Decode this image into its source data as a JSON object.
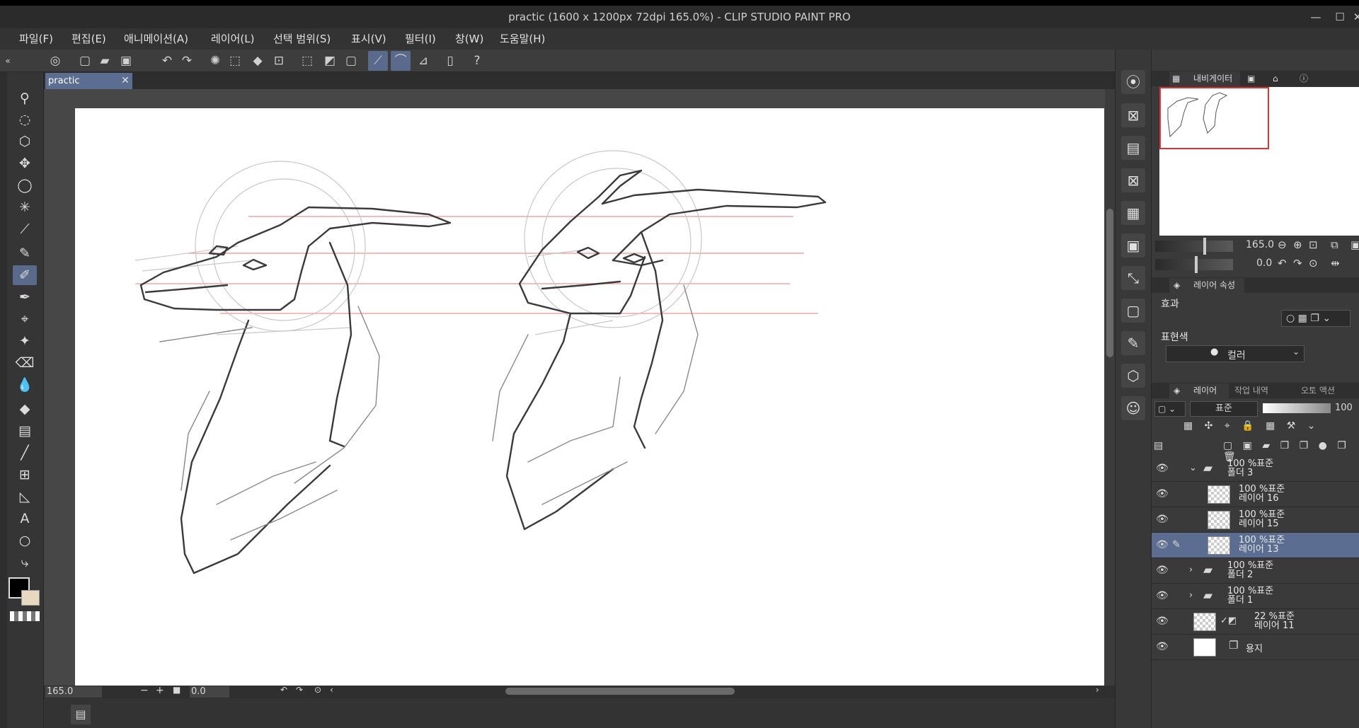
{
  "window": {
    "title": "practic (1600 x 1200px 72dpi 165.0%)  - CLIP STUDIO PAINT PRO",
    "min": "—",
    "max": "☐",
    "close": "✕"
  },
  "menu": [
    "파일(F)",
    "편집(E)",
    "애니메이션(A)",
    "레이어(L)",
    "선택 범위(S)",
    "표시(V)",
    "필터(I)",
    "창(W)",
    "도움말(H)"
  ],
  "document": {
    "tab_label": "practic",
    "tab_close": "✕"
  },
  "colors": {
    "accent": "#5b6d90",
    "main_color": "#000000",
    "sub_color": "#e8d8c0",
    "guide_line": "#f0a0a0"
  },
  "status": {
    "zoom": "165.0",
    "rotation": "0.0"
  },
  "navigator": {
    "tab_label": "내비게이터",
    "zoom_value": "165.0",
    "rotation_value": "0.0"
  },
  "layer_property": {
    "tab_label": "레이어 속성",
    "effect_label": "효과",
    "expression_label": "표현색",
    "expression_value": "컬러"
  },
  "layer_panel": {
    "tabs": [
      "레이어",
      "작업 내역",
      "오토 액션"
    ],
    "blend_mode": "표준",
    "opacity": "100"
  },
  "layers": [
    {
      "line1": "100 %표준",
      "line2": "폴더 3",
      "kind": "folder-open",
      "indent": 0,
      "selected": false
    },
    {
      "line1": "100 %표준",
      "line2": "레이어 16",
      "kind": "raster",
      "indent": 1,
      "selected": false
    },
    {
      "line1": "100 %표준",
      "line2": "레이어 15",
      "kind": "raster",
      "indent": 1,
      "selected": false
    },
    {
      "line1": "100 %표준",
      "line2": "레이어 13",
      "kind": "raster",
      "indent": 1,
      "selected": true
    },
    {
      "line1": "100 %표준",
      "line2": "폴더 2",
      "kind": "folder",
      "indent": 0,
      "selected": false
    },
    {
      "line1": "100 %표준",
      "line2": "폴더 1",
      "kind": "folder",
      "indent": 0,
      "selected": false
    },
    {
      "line1": "22 %표준",
      "line2": "레이어 11",
      "kind": "vector",
      "indent": 0,
      "selected": false
    },
    {
      "line1": "",
      "line2": "용지",
      "kind": "paper",
      "indent": 0,
      "selected": false
    }
  ]
}
